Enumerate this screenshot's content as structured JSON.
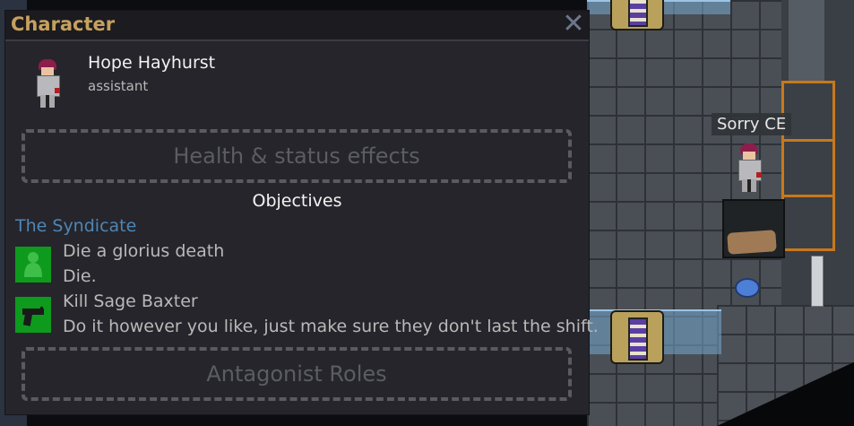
{
  "window": {
    "title": "Character",
    "close_label": "✕"
  },
  "character": {
    "name": "Hope Hayhurst",
    "job": "assistant"
  },
  "buttons": {
    "health": "Health & status effects",
    "antag": "Antagonist Roles"
  },
  "objectives": {
    "heading": "Objectives",
    "faction": "The Syndicate",
    "items": [
      {
        "title": "Die a glorius death",
        "description": "Die.",
        "icon": "ghost-figure-icon"
      },
      {
        "title": "Kill Sage Baxter",
        "description": "Do it however you like, just make sure they don't last the shift.",
        "icon": "pistol-icon"
      }
    ]
  },
  "world": {
    "name_tag": "Sorry CE"
  },
  "colors": {
    "title": "#c6a15e",
    "faction": "#4f86b5",
    "objective_icon_bg": "#0e9a1d",
    "hazard": "#c8781c"
  }
}
